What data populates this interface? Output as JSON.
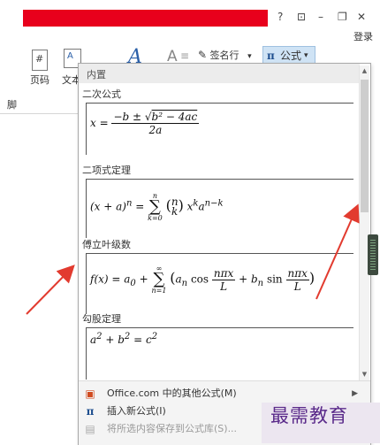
{
  "window": {
    "help": "?",
    "restore_ribbon": "⊡",
    "minimize": "–",
    "maximize": "❐",
    "close": "✕",
    "login": "登录"
  },
  "ribbon": {
    "page_label": "页码",
    "text_label": "文本",
    "signature_label": "签名行",
    "signature_caret": "▾",
    "equation_label": "公式",
    "equation_caret": "▾",
    "footer_label": "脚"
  },
  "gallery": {
    "header": "内置",
    "sections": [
      {
        "title": "二次公式"
      },
      {
        "title": "二项式定理"
      },
      {
        "title": "傅立叶级数"
      },
      {
        "title": "勾股定理"
      }
    ]
  },
  "footer": {
    "items": [
      {
        "label": "Office.com 中的其他公式(M)",
        "icon": "office-icon"
      },
      {
        "label": "插入新公式(I)",
        "icon": "pi-icon"
      },
      {
        "label": "将所选内容保存到公式库(S)...",
        "icon": "save-icon"
      }
    ]
  },
  "watermark": "最需教育",
  "colors": {
    "title_bar_red": "#e8001c",
    "highlight_blue": "#cfe3f5",
    "arrow_red": "#e23b2f",
    "watermark_purple": "#5a2a8a"
  }
}
